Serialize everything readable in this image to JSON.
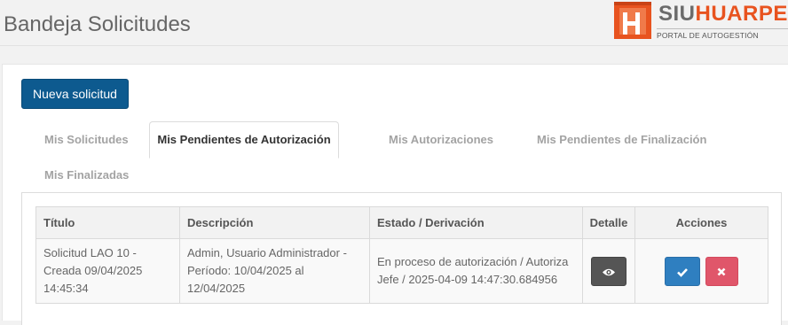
{
  "header": {
    "title": "Bandeja Solicitudes",
    "logo": {
      "name_part1": "SIU",
      "name_part2": "HUARPE",
      "subtitle": "PORTAL DE AUTOGESTIÓN",
      "brand_color": "#e8531f"
    }
  },
  "toolbar": {
    "new_request_label": "Nueva solicitud"
  },
  "tabs": [
    {
      "label": "Mis Solicitudes",
      "active": false
    },
    {
      "label": "Mis Pendientes de Autorización",
      "active": true
    },
    {
      "label": "Mis Autorizaciones",
      "active": false
    },
    {
      "label": "Mis Pendientes de Finalización",
      "active": false
    },
    {
      "label": "Mis Finalizadas",
      "active": false
    }
  ],
  "table": {
    "columns": [
      "Título",
      "Descripción",
      "Estado / Derivación",
      "Detalle",
      "Acciones"
    ],
    "rows": [
      {
        "titulo": "Solicitud LAO 10 - Creada 09/04/2025 14:45:34",
        "descripcion": "Admin, Usuario Administrador - Período: 10/04/2025 al 12/04/2025",
        "estado": "En proceso de autorización / Autoriza Jefe / 2025-04-09 14:47:30.684956",
        "detail_icon": "eye-icon",
        "actions": [
          "check-icon",
          "times-icon"
        ]
      }
    ]
  },
  "colors": {
    "primary_button": "#0d5a8f",
    "approve_button": "#2f7fc0",
    "reject_button": "#e0566a",
    "detail_button": "#555555"
  }
}
